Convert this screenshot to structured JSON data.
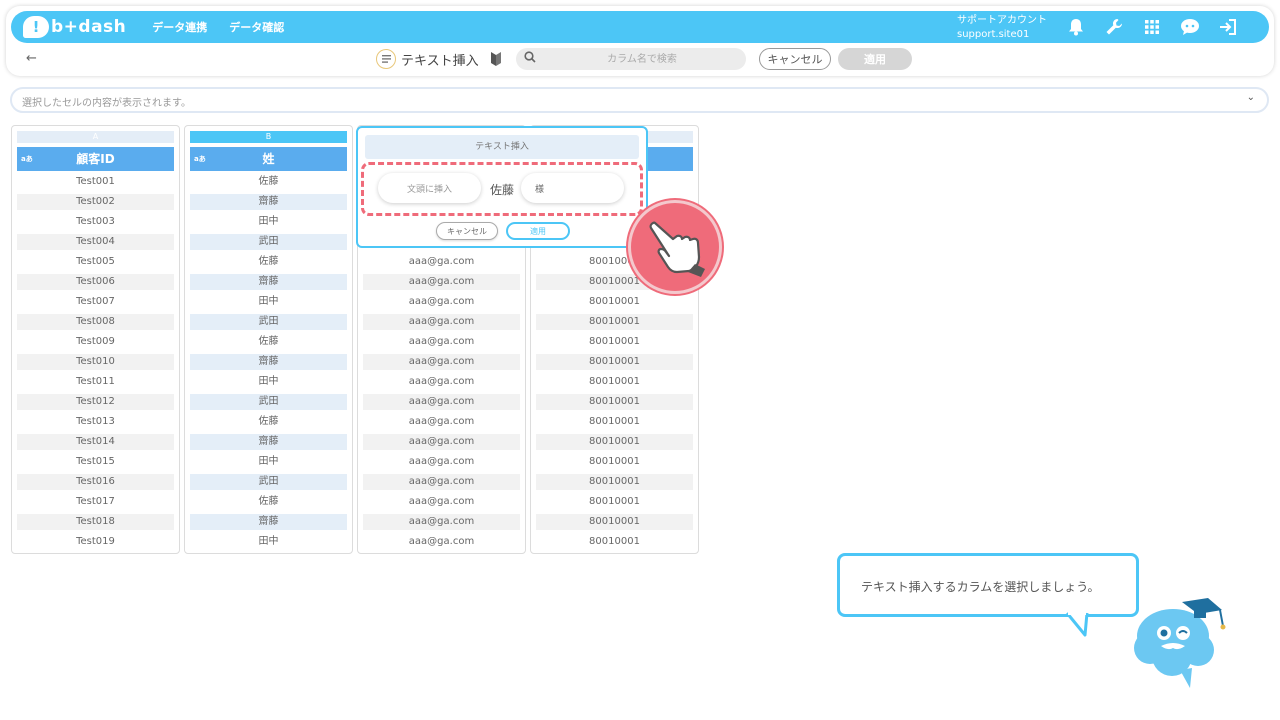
{
  "app": {
    "logo_mark": "!",
    "logo_text": "b+dash",
    "nav": [
      "データ連携",
      "データ確認"
    ],
    "account_name": "サポートアカウント",
    "account_id": "support.site01"
  },
  "toolbar": {
    "back": "←",
    "title": "テキスト挿入",
    "search_placeholder": "カラム名で検索",
    "cancel_label": "キャンセル",
    "apply_label": "適用"
  },
  "cellbar": {
    "placeholder": "選択したセルの内容が表示されます。",
    "chevron": "⌄"
  },
  "columns": [
    {
      "letter": "A",
      "type_badge": "aあ",
      "header": "顧客ID",
      "rows": [
        "Test001",
        "Test002",
        "Test003",
        "Test004",
        "Test005",
        "Test006",
        "Test007",
        "Test008",
        "Test009",
        "Test010",
        "Test011",
        "Test012",
        "Test013",
        "Test014",
        "Test015",
        "Test016",
        "Test017",
        "Test018",
        "Test019"
      ]
    },
    {
      "letter": "B",
      "type_badge": "aあ",
      "header": "姓",
      "rows": [
        "佐藤",
        "齋藤",
        "田中",
        "武田",
        "佐藤",
        "齋藤",
        "田中",
        "武田",
        "佐藤",
        "齋藤",
        "田中",
        "武田",
        "佐藤",
        "齋藤",
        "田中",
        "武田",
        "佐藤",
        "齋藤",
        "田中"
      ]
    },
    {
      "rows": [
        "aaa@ga.com",
        "aaa@ga.com",
        "aaa@ga.com",
        "aaa@ga.com",
        "aaa@ga.com",
        "aaa@ga.com",
        "aaa@ga.com",
        "aaa@ga.com",
        "aaa@ga.com",
        "aaa@ga.com",
        "aaa@ga.com",
        "aaa@ga.com",
        "aaa@ga.com",
        "aaa@ga.com",
        "aaa@ga.com"
      ]
    },
    {
      "rows": [
        "80010001",
        "80010001",
        "80010001",
        "80010001",
        "80010001",
        "80010001",
        "80010001",
        "80010001",
        "80010001",
        "80010001",
        "80010001",
        "80010001",
        "80010001",
        "80010001",
        "80010001"
      ]
    }
  ],
  "popup": {
    "title": "テキスト挿入",
    "prefix_placeholder": "文頭に挿入",
    "sample": "佐藤",
    "suffix_value": "様",
    "cancel_label": "キャンセル",
    "apply_label": "適用"
  },
  "guide": {
    "message": "テキスト挿入するカラムを選択しましょう。"
  },
  "colors": {
    "brand": "#4cc6f6",
    "header_blue": "#5aacee",
    "highlight": "#ef6b7a"
  }
}
